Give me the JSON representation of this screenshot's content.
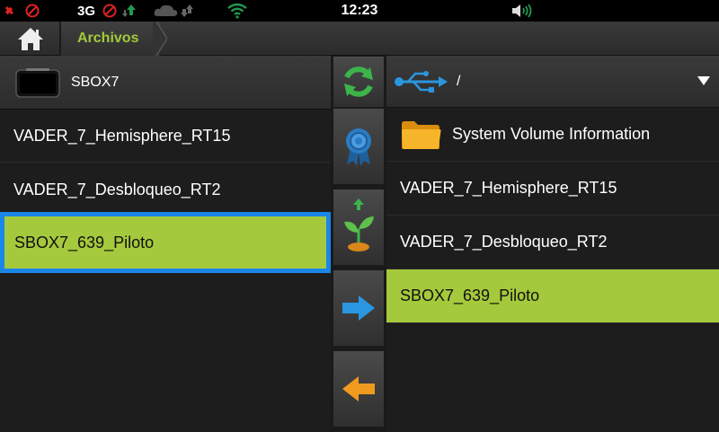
{
  "status_bar": {
    "network_type": "3G",
    "time": "12:23"
  },
  "breadcrumb": {
    "home_icon": "home-icon",
    "current": "Archivos"
  },
  "left_panel": {
    "device_name": "SBOX7",
    "files": [
      {
        "name": "VADER_7_Hemisphere_RT15",
        "selected": false
      },
      {
        "name": "VADER_7_Desbloqueo_RT2",
        "selected": false
      },
      {
        "name": "SBOX7_639_Piloto",
        "selected": true
      }
    ]
  },
  "toolbar": {
    "buttons": [
      "refresh-icon",
      "settings-badge-icon",
      "upgrade-plant-icon",
      "copy-right-arrow-icon",
      "back-left-arrow-icon"
    ]
  },
  "right_panel": {
    "path": "/",
    "items": [
      {
        "name": "System Volume Information",
        "type": "folder",
        "selected": false
      },
      {
        "name": "VADER_7_Hemisphere_RT15",
        "type": "file",
        "selected": false
      },
      {
        "name": "VADER_7_Desbloqueo_RT2",
        "type": "file",
        "selected": false
      },
      {
        "name": "SBOX7_639_Piloto",
        "type": "file",
        "selected": true
      }
    ]
  },
  "colors": {
    "accent_green": "#a5c93c",
    "selection_blue": "#1a86e8",
    "background": "#1d1d1d"
  }
}
